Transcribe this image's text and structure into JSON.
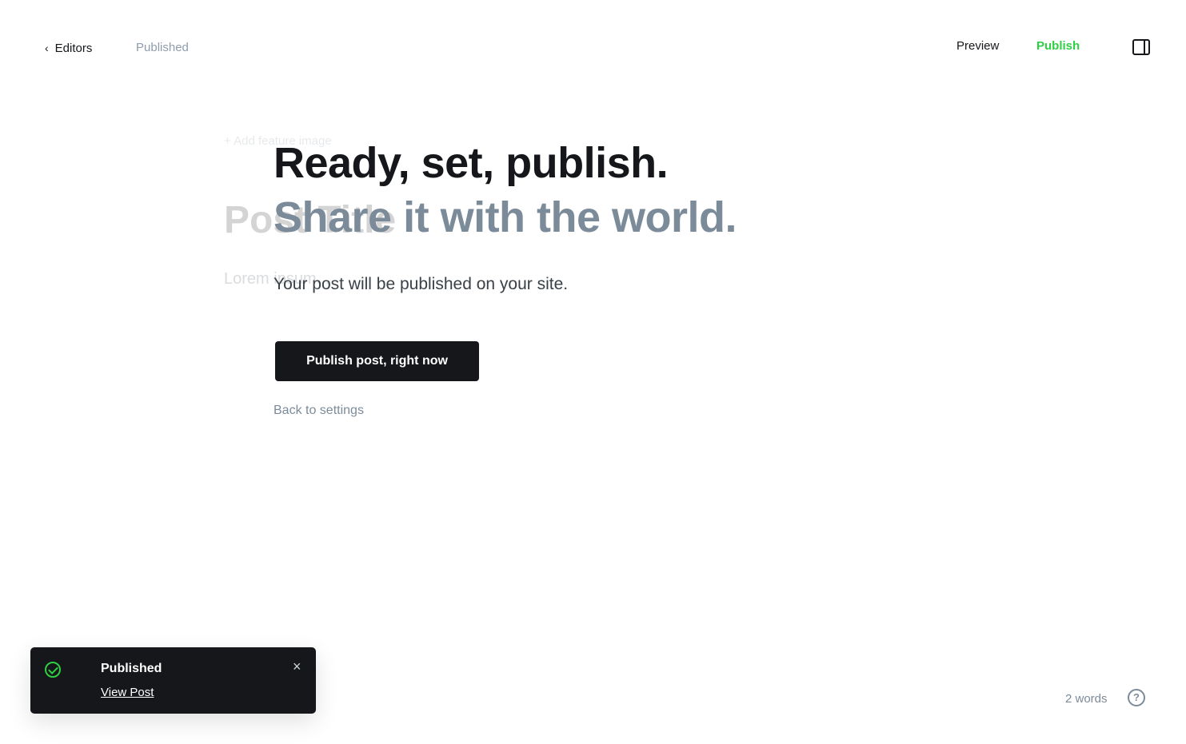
{
  "topbar": {
    "back_label": "Editors",
    "status": "Published",
    "preview_label": "Preview",
    "publish_label": "Publish"
  },
  "editor_bg": {
    "feature_image_label": "+ Add feature image",
    "title": "Post Title",
    "body": "Lorem ipsum..."
  },
  "publish_flow": {
    "title_line1": "Ready, set, publish.",
    "title_line2": "Share it with the world.",
    "description": "Your post will be published on your site.",
    "confirm_label": "Publish post, right now",
    "back_label": "Back to settings"
  },
  "toast": {
    "title": "Published",
    "link": "View Post",
    "close": "×",
    "icon": "check-circle-icon"
  },
  "footer": {
    "word_count": "2 words",
    "help": "?"
  },
  "colors": {
    "accent": "#30cf43",
    "dark": "#15171a",
    "muted": "#7c8b9a"
  }
}
